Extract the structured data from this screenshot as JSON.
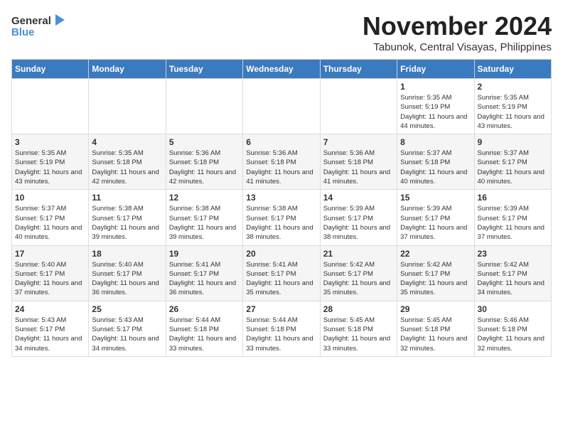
{
  "logo": {
    "general": "General",
    "blue": "Blue"
  },
  "header": {
    "month_year": "November 2024",
    "subtitle": "Tabunok, Central Visayas, Philippines"
  },
  "weekdays": [
    "Sunday",
    "Monday",
    "Tuesday",
    "Wednesday",
    "Thursday",
    "Friday",
    "Saturday"
  ],
  "weeks": [
    [
      {
        "day": "",
        "info": ""
      },
      {
        "day": "",
        "info": ""
      },
      {
        "day": "",
        "info": ""
      },
      {
        "day": "",
        "info": ""
      },
      {
        "day": "",
        "info": ""
      },
      {
        "day": "1",
        "info": "Sunrise: 5:35 AM\nSunset: 5:19 PM\nDaylight: 11 hours and 44 minutes."
      },
      {
        "day": "2",
        "info": "Sunrise: 5:35 AM\nSunset: 5:19 PM\nDaylight: 11 hours and 43 minutes."
      }
    ],
    [
      {
        "day": "3",
        "info": "Sunrise: 5:35 AM\nSunset: 5:19 PM\nDaylight: 11 hours and 43 minutes."
      },
      {
        "day": "4",
        "info": "Sunrise: 5:35 AM\nSunset: 5:18 PM\nDaylight: 11 hours and 42 minutes."
      },
      {
        "day": "5",
        "info": "Sunrise: 5:36 AM\nSunset: 5:18 PM\nDaylight: 11 hours and 42 minutes."
      },
      {
        "day": "6",
        "info": "Sunrise: 5:36 AM\nSunset: 5:18 PM\nDaylight: 11 hours and 41 minutes."
      },
      {
        "day": "7",
        "info": "Sunrise: 5:36 AM\nSunset: 5:18 PM\nDaylight: 11 hours and 41 minutes."
      },
      {
        "day": "8",
        "info": "Sunrise: 5:37 AM\nSunset: 5:18 PM\nDaylight: 11 hours and 40 minutes."
      },
      {
        "day": "9",
        "info": "Sunrise: 5:37 AM\nSunset: 5:17 PM\nDaylight: 11 hours and 40 minutes."
      }
    ],
    [
      {
        "day": "10",
        "info": "Sunrise: 5:37 AM\nSunset: 5:17 PM\nDaylight: 11 hours and 40 minutes."
      },
      {
        "day": "11",
        "info": "Sunrise: 5:38 AM\nSunset: 5:17 PM\nDaylight: 11 hours and 39 minutes."
      },
      {
        "day": "12",
        "info": "Sunrise: 5:38 AM\nSunset: 5:17 PM\nDaylight: 11 hours and 39 minutes."
      },
      {
        "day": "13",
        "info": "Sunrise: 5:38 AM\nSunset: 5:17 PM\nDaylight: 11 hours and 38 minutes."
      },
      {
        "day": "14",
        "info": "Sunrise: 5:39 AM\nSunset: 5:17 PM\nDaylight: 11 hours and 38 minutes."
      },
      {
        "day": "15",
        "info": "Sunrise: 5:39 AM\nSunset: 5:17 PM\nDaylight: 11 hours and 37 minutes."
      },
      {
        "day": "16",
        "info": "Sunrise: 5:39 AM\nSunset: 5:17 PM\nDaylight: 11 hours and 37 minutes."
      }
    ],
    [
      {
        "day": "17",
        "info": "Sunrise: 5:40 AM\nSunset: 5:17 PM\nDaylight: 11 hours and 37 minutes."
      },
      {
        "day": "18",
        "info": "Sunrise: 5:40 AM\nSunset: 5:17 PM\nDaylight: 11 hours and 36 minutes."
      },
      {
        "day": "19",
        "info": "Sunrise: 5:41 AM\nSunset: 5:17 PM\nDaylight: 11 hours and 36 minutes."
      },
      {
        "day": "20",
        "info": "Sunrise: 5:41 AM\nSunset: 5:17 PM\nDaylight: 11 hours and 35 minutes."
      },
      {
        "day": "21",
        "info": "Sunrise: 5:42 AM\nSunset: 5:17 PM\nDaylight: 11 hours and 35 minutes."
      },
      {
        "day": "22",
        "info": "Sunrise: 5:42 AM\nSunset: 5:17 PM\nDaylight: 11 hours and 35 minutes."
      },
      {
        "day": "23",
        "info": "Sunrise: 5:42 AM\nSunset: 5:17 PM\nDaylight: 11 hours and 34 minutes."
      }
    ],
    [
      {
        "day": "24",
        "info": "Sunrise: 5:43 AM\nSunset: 5:17 PM\nDaylight: 11 hours and 34 minutes."
      },
      {
        "day": "25",
        "info": "Sunrise: 5:43 AM\nSunset: 5:17 PM\nDaylight: 11 hours and 34 minutes."
      },
      {
        "day": "26",
        "info": "Sunrise: 5:44 AM\nSunset: 5:18 PM\nDaylight: 11 hours and 33 minutes."
      },
      {
        "day": "27",
        "info": "Sunrise: 5:44 AM\nSunset: 5:18 PM\nDaylight: 11 hours and 33 minutes."
      },
      {
        "day": "28",
        "info": "Sunrise: 5:45 AM\nSunset: 5:18 PM\nDaylight: 11 hours and 33 minutes."
      },
      {
        "day": "29",
        "info": "Sunrise: 5:45 AM\nSunset: 5:18 PM\nDaylight: 11 hours and 32 minutes."
      },
      {
        "day": "30",
        "info": "Sunrise: 5:46 AM\nSunset: 5:18 PM\nDaylight: 11 hours and 32 minutes."
      }
    ]
  ]
}
